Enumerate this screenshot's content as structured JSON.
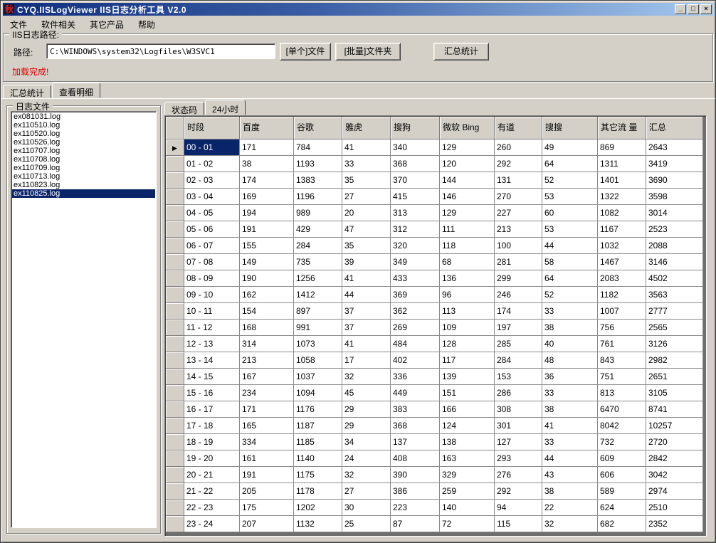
{
  "window": {
    "title": "CYQ.IISLogViewer IIS日志分析工具 V2.0",
    "app_icon_char": "秋",
    "controls": {
      "minimize": "_",
      "maximize": "□",
      "close": "×"
    }
  },
  "menu": {
    "items": [
      "文件",
      "软件相关",
      "其它产品",
      "帮助"
    ]
  },
  "path_panel": {
    "group_label": "IIS日志路径:",
    "path_label": "路径:",
    "path_value": "C:\\WINDOWS\\system32\\Logfiles\\W3SVC1",
    "buttons": [
      "[单个]文件",
      "[批量]文件夹",
      "汇总统计"
    ],
    "status_text": "加载完成!"
  },
  "main_tabs": {
    "items": [
      "汇总统计",
      "查看明细"
    ],
    "active_index": 1
  },
  "log_panel": {
    "group_label": "日志文件",
    "files": [
      "ex081031.log",
      "ex110510.log",
      "ex110520.log",
      "ex110526.log",
      "ex110707.log",
      "ex110708.log",
      "ex110709.log",
      "ex110713.log",
      "ex110823.log",
      "ex110825.log"
    ],
    "selected_index": 9
  },
  "detail_tabs": {
    "items": [
      "状态码",
      "24小时"
    ],
    "active_index": 1
  },
  "grid": {
    "columns": [
      "时段",
      "百度",
      "谷歌",
      "雅虎",
      "搜狗",
      "微软\nBing",
      "有道",
      "搜搜",
      "其它流\n量",
      "汇总"
    ],
    "selected_row_index": 0,
    "selected_col_index": 0,
    "rows": [
      [
        "00 - 01",
        171,
        784,
        41,
        340,
        129,
        260,
        49,
        869,
        2643
      ],
      [
        "01 - 02",
        38,
        1193,
        33,
        368,
        120,
        292,
        64,
        1311,
        3419
      ],
      [
        "02 - 03",
        174,
        1383,
        35,
        370,
        144,
        131,
        52,
        1401,
        3690
      ],
      [
        "03 - 04",
        169,
        1196,
        27,
        415,
        146,
        270,
        53,
        1322,
        3598
      ],
      [
        "04 - 05",
        194,
        989,
        20,
        313,
        129,
        227,
        60,
        1082,
        3014
      ],
      [
        "05 - 06",
        191,
        429,
        47,
        312,
        111,
        213,
        53,
        1167,
        2523
      ],
      [
        "06 - 07",
        155,
        284,
        35,
        320,
        118,
        100,
        44,
        1032,
        2088
      ],
      [
        "07 - 08",
        149,
        735,
        39,
        349,
        68,
        281,
        58,
        1467,
        3146
      ],
      [
        "08 - 09",
        190,
        1256,
        41,
        433,
        136,
        299,
        64,
        2083,
        4502
      ],
      [
        "09 - 10",
        162,
        1412,
        44,
        369,
        96,
        246,
        52,
        1182,
        3563
      ],
      [
        "10 - 11",
        154,
        897,
        37,
        362,
        113,
        174,
        33,
        1007,
        2777
      ],
      [
        "11 - 12",
        168,
        991,
        37,
        269,
        109,
        197,
        38,
        756,
        2565
      ],
      [
        "12 - 13",
        314,
        1073,
        41,
        484,
        128,
        285,
        40,
        761,
        3126
      ],
      [
        "13 - 14",
        213,
        1058,
        17,
        402,
        117,
        284,
        48,
        843,
        2982
      ],
      [
        "14 - 15",
        167,
        1037,
        32,
        336,
        139,
        153,
        36,
        751,
        2651
      ],
      [
        "15 - 16",
        234,
        1094,
        45,
        449,
        151,
        286,
        33,
        813,
        3105
      ],
      [
        "16 - 17",
        171,
        1176,
        29,
        383,
        166,
        308,
        38,
        6470,
        8741
      ],
      [
        "17 - 18",
        165,
        1187,
        29,
        368,
        124,
        301,
        41,
        8042,
        10257
      ],
      [
        "18 - 19",
        334,
        1185,
        34,
        137,
        138,
        127,
        33,
        732,
        2720
      ],
      [
        "19 - 20",
        161,
        1140,
        24,
        408,
        163,
        293,
        44,
        609,
        2842
      ],
      [
        "20 - 21",
        191,
        1175,
        32,
        390,
        329,
        276,
        43,
        606,
        3042
      ],
      [
        "21 - 22",
        205,
        1178,
        27,
        386,
        259,
        292,
        38,
        589,
        2974
      ],
      [
        "22 - 23",
        175,
        1202,
        30,
        223,
        140,
        94,
        22,
        624,
        2510
      ],
      [
        "23 - 24",
        207,
        1132,
        25,
        87,
        72,
        115,
        32,
        682,
        2352
      ]
    ]
  },
  "colors": {
    "selection": "#0a246a",
    "status_red": "#dd0000",
    "titlebar_left": "#0f2e7e",
    "titlebar_right": "#a6caf0",
    "face": "#d4d0c8"
  }
}
